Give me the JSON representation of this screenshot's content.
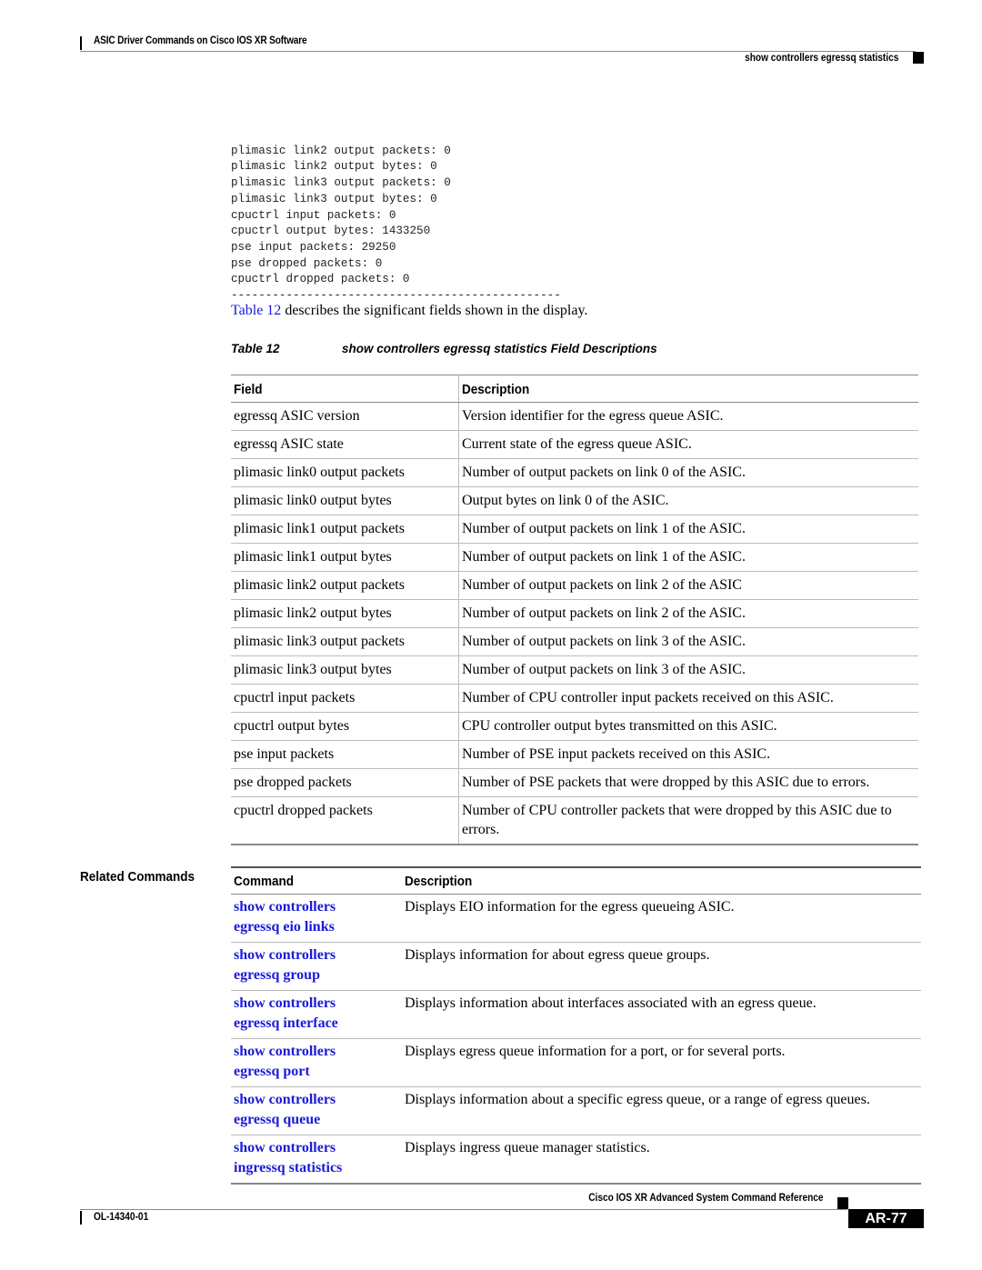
{
  "header": {
    "chapter_title": "ASIC Driver Commands on Cisco IOS XR Software",
    "section_title": "show controllers egressq statistics"
  },
  "code_output": {
    "lines": [
      "plimasic link2 output packets: 0",
      "plimasic link2 output bytes: 0",
      "plimasic link3 output packets: 0",
      "plimasic link3 output bytes: 0",
      "cpuctrl input packets: 0",
      "cpuctrl output bytes: 1433250",
      "pse input packets: 29250",
      "pse dropped packets: 0",
      "cpuctrl dropped packets: 0",
      "------------------------------------------------"
    ]
  },
  "intro": {
    "link_text": "Table 12",
    "rest": " describes the significant fields shown in the display."
  },
  "field_table": {
    "caption_number": "Table 12",
    "caption_title": "show controllers egressq statistics Field Descriptions",
    "headers": [
      "Field",
      "Description"
    ],
    "rows": [
      {
        "field": "egressq ASIC version",
        "description": "Version identifier for the egress queue ASIC."
      },
      {
        "field": "egressq ASIC state",
        "description": "Current state of the egress queue ASIC."
      },
      {
        "field": "plimasic link0 output packets",
        "description": "Number of output packets on link 0 of the ASIC."
      },
      {
        "field": "plimasic link0 output bytes",
        "description": "Output bytes on link 0 of the ASIC."
      },
      {
        "field": "plimasic link1 output packets",
        "description": "Number of output packets on link 1 of the ASIC."
      },
      {
        "field": "plimasic link1 output bytes",
        "description": "Number of output packets on link 1 of the ASIC."
      },
      {
        "field": "plimasic link2 output packets",
        "description": "Number of output packets on link 2 of the ASIC"
      },
      {
        "field": "plimasic link2 output bytes",
        "description": "Number of output packets on link 2 of the ASIC."
      },
      {
        "field": "plimasic link3 output packets",
        "description": "Number of output packets on link 3 of the ASIC."
      },
      {
        "field": "plimasic link3 output bytes",
        "description": "Number of output packets on link 3 of the ASIC."
      },
      {
        "field": "cpuctrl input packets",
        "description": "Number of CPU controller input packets received on this ASIC."
      },
      {
        "field": "cpuctrl output bytes",
        "description": "CPU controller output bytes transmitted on this ASIC."
      },
      {
        "field": "pse input packets",
        "description": "Number of PSE input packets received on this ASIC."
      },
      {
        "field": "pse dropped packets",
        "description": "Number of PSE packets that were dropped by this ASIC due to errors."
      },
      {
        "field": "cpuctrl dropped packets",
        "description": "Number of CPU controller packets that were dropped by this ASIC due to errors."
      }
    ]
  },
  "related_commands": {
    "label": "Related Commands",
    "headers": [
      "Command",
      "Description"
    ],
    "rows": [
      {
        "command_line1": "show controllers",
        "command_line2": "egressq eio links",
        "description": "Displays EIO information for the egress queueing ASIC."
      },
      {
        "command_line1": "show controllers",
        "command_line2": "egressq group",
        "description": "Displays information for about egress queue groups."
      },
      {
        "command_line1": "show controllers",
        "command_line2": "egressq interface",
        "description": "Displays information about interfaces associated with an egress queue."
      },
      {
        "command_line1": "show controllers",
        "command_line2": "egressq port",
        "description": "Displays egress queue information for a port, or for several ports."
      },
      {
        "command_line1": "show controllers",
        "command_line2": "egressq queue",
        "description": "Displays information about a specific egress queue, or a range of egress queues."
      },
      {
        "command_line1": "show controllers",
        "command_line2": "ingressq statistics",
        "description": "Displays ingress queue manager statistics."
      }
    ]
  },
  "footer": {
    "book_title": "Cisco IOS XR Advanced System Command Reference",
    "doc_number": "OL-14340-01",
    "page_number": "AR-77"
  },
  "colors": {
    "link": "#1a1adb",
    "text": "#000000",
    "rule": "#888888"
  }
}
